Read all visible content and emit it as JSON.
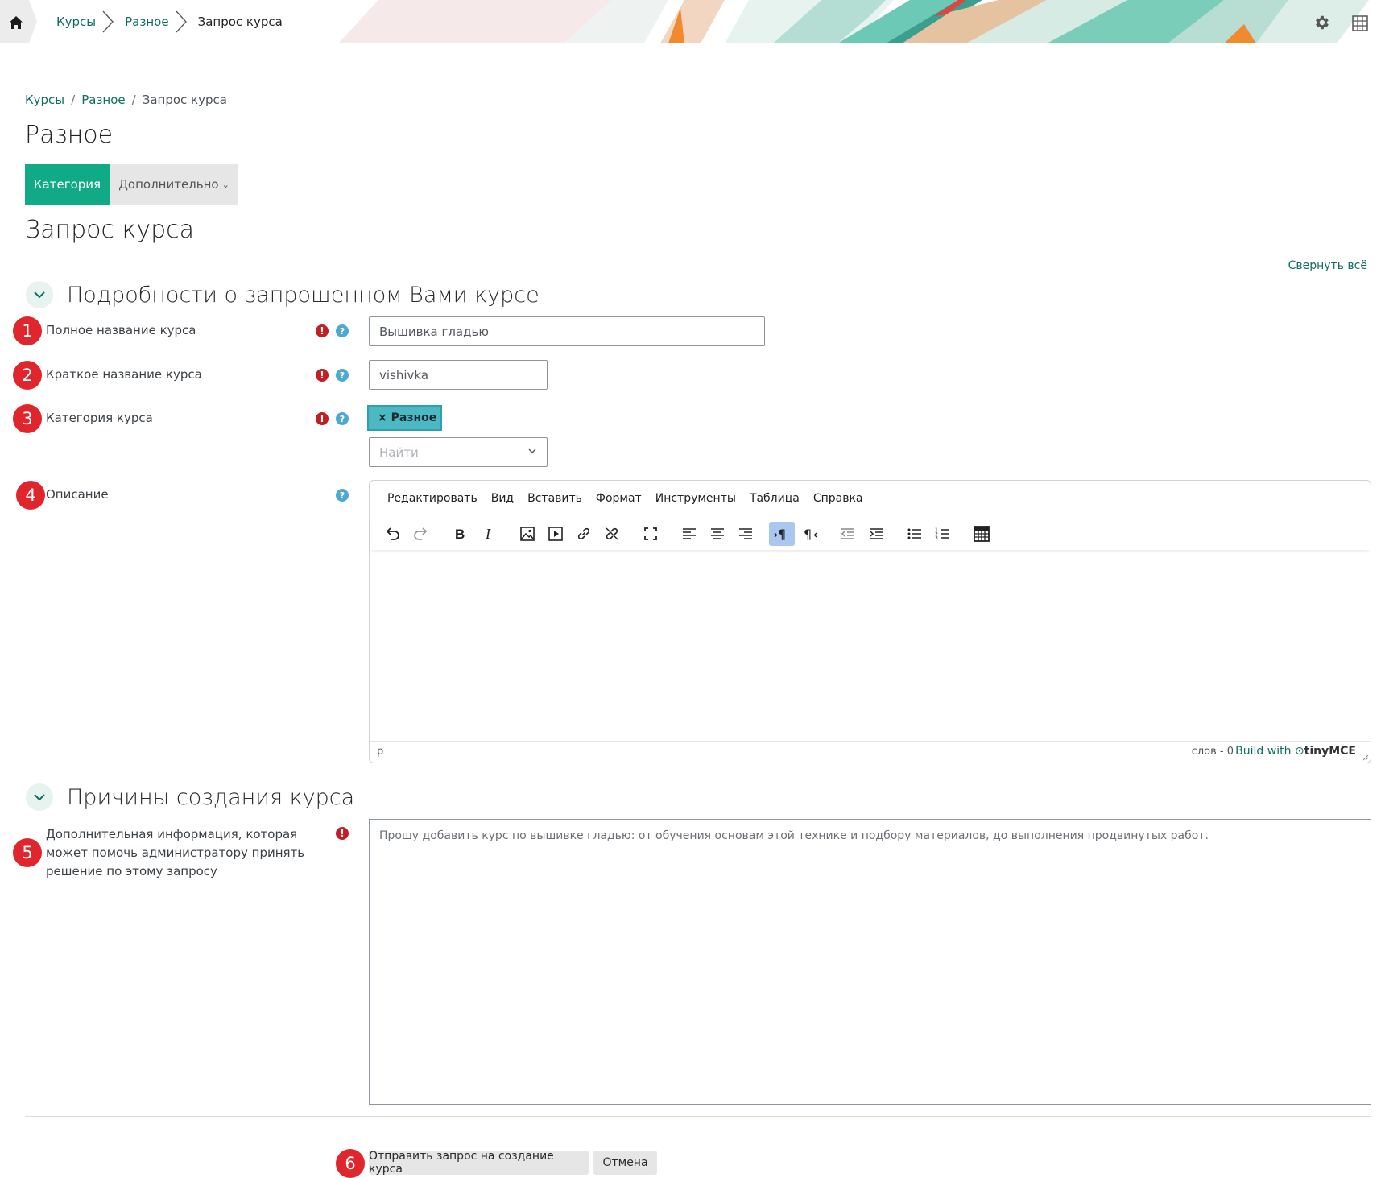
{
  "topbar": {
    "crumbs": [
      "Курсы",
      "Разное",
      "Запрос курса"
    ]
  },
  "breadcrumb": {
    "items": [
      "Курсы",
      "Разное",
      "Запрос курса"
    ],
    "separator": "/"
  },
  "page_title": "Разное",
  "tabs": {
    "active": "Категория",
    "more": "Дополнительно"
  },
  "form_title": "Запрос курса",
  "collapse_all": "Свернуть всё",
  "section1": {
    "title": "Подробности о запрошенном Вами курсе",
    "fullname": {
      "badge": "1",
      "label": "Полное название курса",
      "value": "Вышивка гладью"
    },
    "shortname": {
      "badge": "2",
      "label": "Краткое название курса",
      "value": "vishivka"
    },
    "category": {
      "badge": "3",
      "label": "Категория курса",
      "chip": "× Разное",
      "search_placeholder": "Найти"
    },
    "description": {
      "badge": "4",
      "label": "Описание"
    }
  },
  "editor": {
    "menu": [
      "Редактировать",
      "Вид",
      "Вставить",
      "Формат",
      "Инструменты",
      "Таблица",
      "Справка"
    ],
    "status_path": "p",
    "word_count": "слов - 0",
    "brand_prefix": "Build with",
    "brand_name": "tinyMCE"
  },
  "section2": {
    "title": "Причины создания курса",
    "reason": {
      "badge": "5",
      "label": "Дополнительная информация, которая может помочь администратору принять решение по этому запросу",
      "value": "Прошу добавить курс по вышивке гладью: от обучения основам этой технике и подбору материалов, до выполнения продвинутых работ."
    }
  },
  "actions": {
    "badge": "6",
    "submit": "Отправить запрос на создание курса",
    "cancel": "Отмена"
  },
  "colors": {
    "accent": "#10ab86",
    "link": "#0f6e61",
    "badge": "#e0262c",
    "required": "#c21f25",
    "help": "#4da8d4"
  }
}
